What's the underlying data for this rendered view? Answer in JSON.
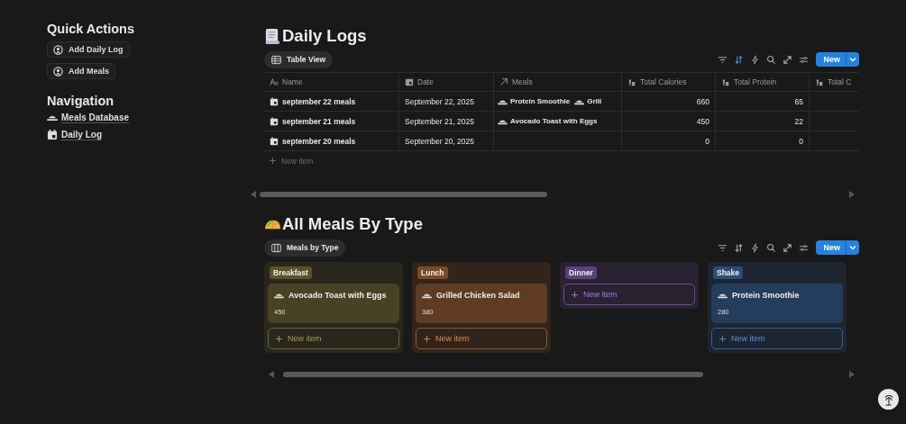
{
  "sidebar": {
    "quick_actions_title": "Quick Actions",
    "actions": [
      {
        "label": "Add Daily Log"
      },
      {
        "label": "Add Meals"
      }
    ],
    "navigation_title": "Navigation",
    "links": [
      {
        "label": "Meals Database",
        "kind": "meals"
      },
      {
        "label": "Daily Log",
        "kind": "calendar"
      }
    ]
  },
  "daily_logs": {
    "title": "Daily Logs",
    "view_tab": "Table View",
    "sort_active": true,
    "new_button": "New",
    "columns": [
      {
        "label": "Name",
        "kind": "text"
      },
      {
        "label": "Date",
        "kind": "date"
      },
      {
        "label": "Meals",
        "kind": "relation"
      },
      {
        "label": "Total Calories",
        "kind": "rollup"
      },
      {
        "label": "Total Protein",
        "kind": "rollup"
      },
      {
        "label": "Total C",
        "kind": "rollup"
      }
    ],
    "rows": [
      {
        "name": "september 22 meals",
        "date": "September 22, 2025",
        "meals": [
          "Protein Smoothie",
          "Grill"
        ],
        "calories": "660",
        "protein": "65"
      },
      {
        "name": "september 21 meals",
        "date": "September 21, 2025",
        "meals": [
          "Avocado Toast with Eggs"
        ],
        "calories": "450",
        "protein": "22"
      },
      {
        "name": "september 20 meals",
        "date": "September 20, 2025",
        "meals": [],
        "calories": "0",
        "protein": "0"
      }
    ],
    "new_item": "New item"
  },
  "meals_by_type": {
    "title": "All Meals By Type",
    "view_tab": "Meals by Type",
    "sort_active": false,
    "new_button": "New",
    "groups": [
      {
        "name": "Breakfast",
        "color": "#5c5228",
        "cards": [
          {
            "title": "Avocado Toast with Eggs",
            "calories": "450"
          }
        ],
        "new_item": "New item"
      },
      {
        "name": "Lunch",
        "color": "#7a4a24",
        "cards": [
          {
            "title": "Grilled Chicken Salad",
            "calories": "380"
          }
        ],
        "new_item": "New item"
      },
      {
        "name": "Dinner",
        "color": "#5d3f7c",
        "new_item": "New item"
      },
      {
        "name": "Shake",
        "color": "#2b4d78",
        "cards": [
          {
            "title": "Protein Smoothie",
            "calories": "280"
          }
        ],
        "new_item": "New item"
      }
    ]
  }
}
